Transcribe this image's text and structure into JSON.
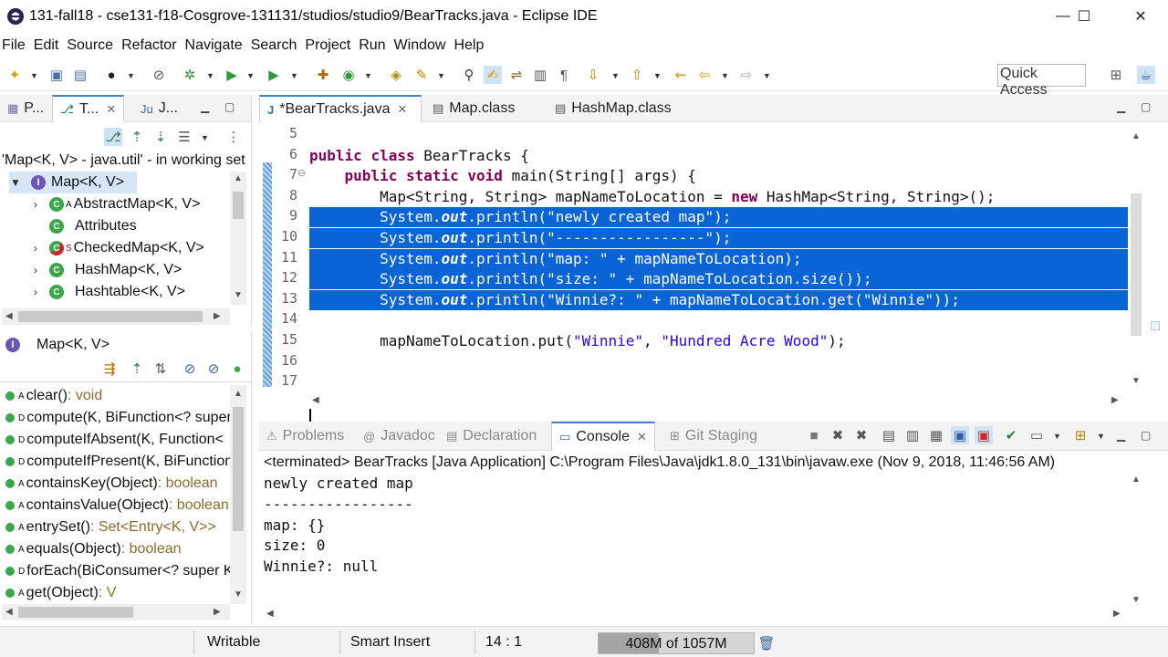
{
  "window": {
    "title": "131-fall18 - cse131-f18-Cosgrove-131131/studios/studio9/BearTracks.java - Eclipse IDE",
    "minimize": "—",
    "maximize": "☐",
    "close": "✕"
  },
  "menu": [
    "File",
    "Edit",
    "Source",
    "Refactor",
    "Navigate",
    "Search",
    "Project",
    "Run",
    "Window",
    "Help"
  ],
  "toolbar": {
    "quick_access": "Quick Access"
  },
  "left_top": {
    "tabs": [
      {
        "icon": "package-explorer-icon",
        "label": "P..."
      },
      {
        "icon": "type-hierarchy-icon",
        "label": "T..."
      },
      {
        "icon": "junit-icon",
        "label": "J..."
      }
    ],
    "close": "✕",
    "hierarchy_info": "'Map<K, V> - java.util' - in working set",
    "items": [
      {
        "label": "Map<K, V>",
        "kind": "interface",
        "expanded": true,
        "sup": ""
      },
      {
        "label": "AbstractMap<K, V>",
        "kind": "class",
        "expanded": false,
        "sup": "A"
      },
      {
        "label": "Attributes",
        "kind": "class",
        "expanded": null,
        "sup": ""
      },
      {
        "label": "CheckedMap<K, V>",
        "kind": "class",
        "expanded": false,
        "sup": "S"
      },
      {
        "label": "HashMap<K, V>",
        "kind": "class",
        "expanded": false,
        "sup": ""
      },
      {
        "label": "Hashtable<K, V>",
        "kind": "class",
        "expanded": false,
        "sup": ""
      }
    ]
  },
  "left_bottom": {
    "title": "Map<K, V>",
    "members": [
      {
        "sup": "A",
        "name": "clear()",
        "type": " : void"
      },
      {
        "sup": "D",
        "name": "compute(K, BiFunction<? super",
        "type": ""
      },
      {
        "sup": "D",
        "name": "computeIfAbsent(K, Function<",
        "type": ""
      },
      {
        "sup": "D",
        "name": "computeIfPresent(K, BiFunction",
        "type": ""
      },
      {
        "sup": "A",
        "name": "containsKey(Object)",
        "type": " : boolean"
      },
      {
        "sup": "A",
        "name": "containsValue(Object)",
        "type": " : boolean"
      },
      {
        "sup": "A",
        "name": "entrySet()",
        "type": " : Set<Entry<K, V>>"
      },
      {
        "sup": "A",
        "name": "equals(Object)",
        "type": " : boolean"
      },
      {
        "sup": "D",
        "name": "forEach(BiConsumer<? super K",
        "type": ""
      },
      {
        "sup": "A",
        "name": "get(Object)",
        "type": " : V"
      }
    ]
  },
  "editor": {
    "tabs": [
      {
        "label": "*BearTracks.java",
        "active": true,
        "close": "✕"
      },
      {
        "label": "Map.class",
        "active": false
      },
      {
        "label": "HashMap.class",
        "active": false
      }
    ],
    "lines": [
      {
        "n": "5",
        "html": ""
      },
      {
        "n": "6",
        "html": "<span class=\"kw\">public</span> <span class=\"kw\">class</span> BearTracks {"
      },
      {
        "n": "7",
        "html": "    <span class=\"kw\">public</span> <span class=\"kw\">static</span> <span class=\"kw\">void</span> main(String[] args) {",
        "fold": "⊖"
      },
      {
        "n": "8",
        "html": "        Map&lt;String, String&gt; mapNameToLocation = <span class=\"kw\">new</span> HashMap&lt;String, String&gt;();"
      },
      {
        "n": "9",
        "html": "        System.<span class=\"fl\">out</span>.println(<span class=\"st\">\"newly created map\"</span>);",
        "selected": true
      },
      {
        "n": "10",
        "html": "        System.<span class=\"fl\">out</span>.println(<span class=\"st\">\"-----------------\"</span>);",
        "selected": true
      },
      {
        "n": "11",
        "html": "        System.<span class=\"fl\">out</span>.println(<span class=\"st\">\"map: \"</span> + mapNameToLocation);",
        "selected": true
      },
      {
        "n": "12",
        "html": "        System.<span class=\"fl\">out</span>.println(<span class=\"st\">\"size: \"</span> + mapNameToLocation.size());",
        "selected": true
      },
      {
        "n": "13",
        "html": "        System.<span class=\"fl\">out</span>.println(<span class=\"st\">\"Winnie?: \"</span> + mapNameToLocation.get(<span class=\"st\">\"Winnie\"</span>));",
        "selected": true
      },
      {
        "n": "14",
        "html": ""
      },
      {
        "n": "15",
        "html": "        mapNameToLocation.put(<span class=\"st\">\"Winnie\"</span>, <span class=\"st\">\"Hundred Acre Wood\"</span>);"
      },
      {
        "n": "16",
        "html": ""
      },
      {
        "n": "17",
        "html": ""
      }
    ]
  },
  "console": {
    "tabs": [
      {
        "label": "Problems",
        "active": false
      },
      {
        "label": "Javadoc",
        "active": false
      },
      {
        "label": "Declaration",
        "active": false
      },
      {
        "label": "Console",
        "active": true,
        "close": "✕"
      },
      {
        "label": "Git Staging",
        "active": false
      }
    ],
    "header": "<terminated> BearTracks [Java Application] C:\\Program Files\\Java\\jdk1.8.0_131\\bin\\javaw.exe (Nov 9, 2018, 11:46:56 AM)",
    "output": [
      "newly created map",
      "-----------------",
      "map: {}",
      "size: 0",
      "Winnie?: null"
    ]
  },
  "status": {
    "writable": "Writable",
    "insert_mode": "Smart Insert",
    "position": "14 : 1",
    "heap": "408M of 1057M",
    "heap_fraction": 0.386
  },
  "colors": {
    "selection": "#0a64d6",
    "keyword": "#7f0055",
    "string": "#2a00ff"
  }
}
